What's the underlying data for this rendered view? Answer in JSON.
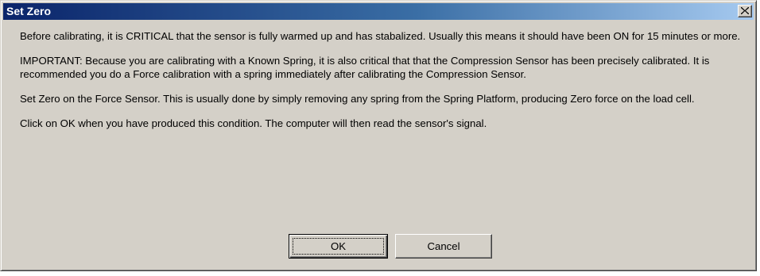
{
  "window": {
    "title": "Set Zero",
    "close_icon": "close-x-icon"
  },
  "message": {
    "paragraphs": [
      "Before calibrating, it is CRITICAL that the sensor is fully warmed up and has stabalized.  Usually this means it should have been ON for 15 minutes or more.",
      "IMPORTANT:  Because you are calibrating with a Known Spring, it is also critical that that the Compression Sensor has been precisely calibrated.  It is recommended you do a Force calibration with a spring immediately after calibrating the Compression Sensor.",
      "Set Zero on the Force Sensor.  This is usually done by simply removing any spring from the Spring Platform, producing Zero force on the load cell.",
      "Click on OK when you have produced this condition.  The computer will then read the sensor's signal."
    ]
  },
  "buttons": {
    "ok_label": "OK",
    "cancel_label": "Cancel"
  },
  "colors": {
    "titlebar_start": "#0a246a",
    "titlebar_end": "#a6caf0",
    "dialog_face": "#d4d0c8"
  }
}
